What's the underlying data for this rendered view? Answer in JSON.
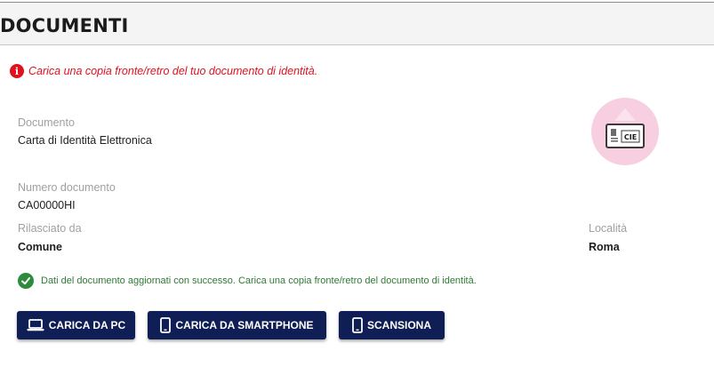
{
  "header": {
    "title": "DOCUMENTI"
  },
  "alerts": {
    "warning": "Carica una copia fronte/retro del tuo documento di identità.",
    "success": "Dati del documento aggiornati con successo. Carica una copia fronte/retro del documento di identità."
  },
  "document": {
    "type_label": "Documento",
    "type_value": "Carta di Identità Elettronica",
    "number_label": "Numero documento",
    "number_value": "CA00000HI",
    "issuer_label": "Rilasciato da",
    "issuer_value": "Comune",
    "place_label": "Località",
    "place_value": "Roma",
    "badge_text": "CIE"
  },
  "buttons": {
    "upload_pc": "CARICA DA PC",
    "upload_smartphone": "CARICA DA SMARTPHONE",
    "scan": "SCANSIONA"
  },
  "icons": {
    "warning": "info-circle-icon",
    "success": "check-circle-icon",
    "badge": "id-card-icon",
    "upload_pc": "laptop-icon",
    "upload_smartphone": "smartphone-icon",
    "scan": "smartphone-icon"
  },
  "colors": {
    "primary_button": "#0f1e55",
    "error": "#e0101e",
    "success": "#2e8b3e",
    "badge_background": "#f8cfe0"
  }
}
